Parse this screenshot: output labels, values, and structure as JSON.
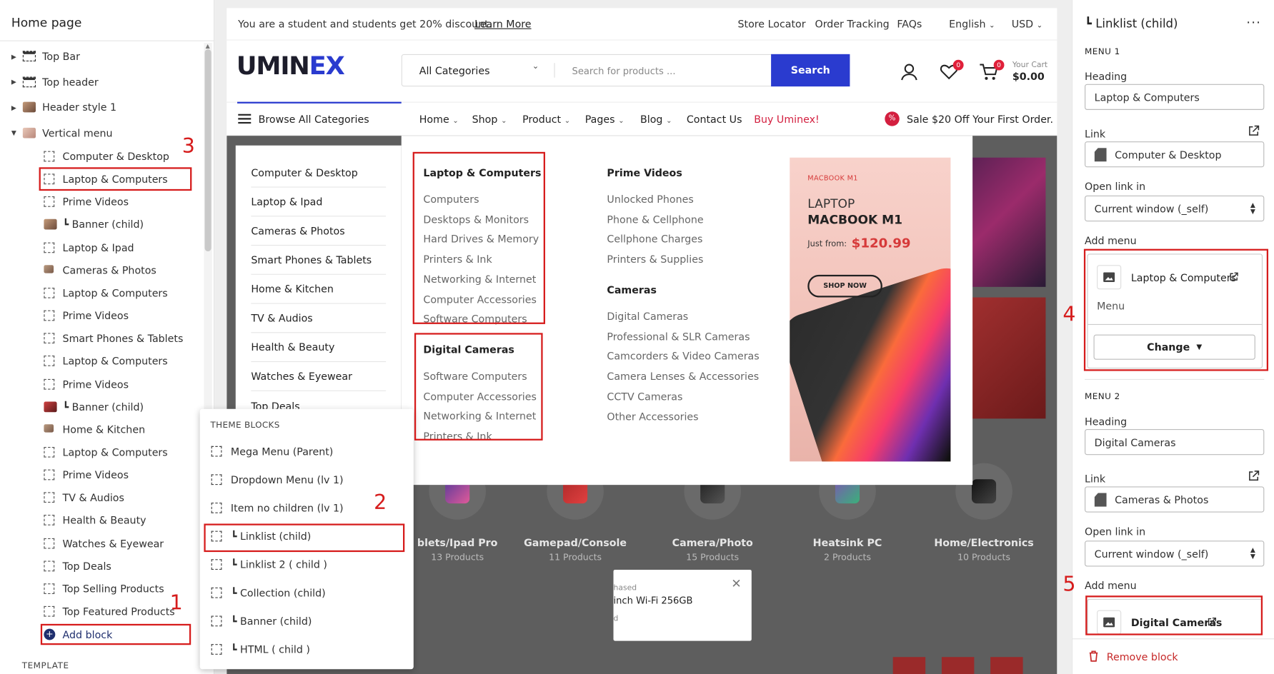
{
  "left_panel": {
    "title": "Home page",
    "tree": [
      {
        "label": "Top Bar",
        "type": "section",
        "icon": "section-bar-icon"
      },
      {
        "label": "Top header",
        "type": "section",
        "icon": "section-bar-icon"
      },
      {
        "label": "Header style 1",
        "type": "section",
        "icon": "image-thumb-icon"
      },
      {
        "label": "Vertical menu",
        "type": "section",
        "icon": "image-thumb-icon",
        "expanded": true
      },
      {
        "label": "Computer & Desktop",
        "type": "block",
        "icon": "frame-icon"
      },
      {
        "label": "Laptop & Computers",
        "type": "block",
        "icon": "frame-icon"
      },
      {
        "label": "Prime Videos",
        "type": "block",
        "icon": "frame-icon"
      },
      {
        "label": "┗ Banner (child)",
        "type": "block",
        "icon": "image-thumb-icon"
      },
      {
        "label": "Laptop & Ipad",
        "type": "block",
        "icon": "frame-icon"
      },
      {
        "label": "Cameras & Photos",
        "type": "block",
        "icon": "small-thumb-icon"
      },
      {
        "label": "Laptop & Computers",
        "type": "block",
        "icon": "frame-icon"
      },
      {
        "label": "Prime Videos",
        "type": "block",
        "icon": "frame-icon"
      },
      {
        "label": "Smart Phones & Tablets",
        "type": "block",
        "icon": "frame-icon"
      },
      {
        "label": "Laptop & Computers",
        "type": "block",
        "icon": "frame-icon"
      },
      {
        "label": "Prime Videos",
        "type": "block",
        "icon": "frame-icon"
      },
      {
        "label": "┗ Banner (child)",
        "type": "block",
        "icon": "red-thumb-icon"
      },
      {
        "label": "Home & Kitchen",
        "type": "block",
        "icon": "small-thumb-icon"
      },
      {
        "label": "Laptop & Computers",
        "type": "block",
        "icon": "frame-icon"
      },
      {
        "label": "Prime Videos",
        "type": "block",
        "icon": "frame-icon"
      },
      {
        "label": "TV & Audios",
        "type": "block",
        "icon": "frame-icon"
      },
      {
        "label": "Health & Beauty",
        "type": "block",
        "icon": "frame-icon"
      },
      {
        "label": "Watches & Eyewear",
        "type": "block",
        "icon": "frame-icon"
      },
      {
        "label": "Top Deals",
        "type": "block",
        "icon": "frame-icon"
      },
      {
        "label": "Top Selling Products",
        "type": "block",
        "icon": "frame-icon"
      },
      {
        "label": "Top Featured Products",
        "type": "block",
        "icon": "frame-icon"
      }
    ],
    "add_block": "Add block",
    "template_label": "TEMPLATE"
  },
  "annotations": [
    "1",
    "2",
    "3",
    "4",
    "5"
  ],
  "theme_blocks": {
    "heading": "THEME BLOCKS",
    "items": [
      "Mega Menu (Parent)",
      "Dropdown Menu (lv 1)",
      "Item no children (lv 1)",
      "┗ Linklist (child)",
      "┗ Linklist 2 ( child )",
      "┗ Collection (child)",
      "┗ Banner (child)",
      "┗ HTML ( child )"
    ]
  },
  "site": {
    "topbar": {
      "promo_text": "You are a student and students get 20% discount.",
      "promo_link": "Learn More",
      "links": [
        "Store Locator",
        "Order Tracking",
        "FAQs"
      ],
      "language": "English",
      "currency": "USD"
    },
    "header": {
      "logo": "UMINEX",
      "category_select": "All Categories",
      "search_placeholder": "Search for products ...",
      "search_button": "Search",
      "wishlist_count": "0",
      "cart_count": "0",
      "cart_label": "Your Cart",
      "cart_total": "$0.00"
    },
    "nav": {
      "browse": "Browse All Categories",
      "items": [
        "Home",
        "Shop",
        "Product",
        "Pages",
        "Blog",
        "Contact Us"
      ],
      "buy": "Buy Uminex!",
      "sale": "Sale $20 Off Your First Order."
    },
    "side_categories": [
      "Computer & Desktop",
      "Laptop & Ipad",
      "Cameras & Photos",
      "Smart Phones & Tablets",
      "Home & Kitchen",
      "TV & Audios",
      "Health & Beauty",
      "Watches & Eyewear",
      "Top Deals"
    ],
    "mega": {
      "col1_title": "Laptop & Computers",
      "col1_links": [
        "Computers",
        "Desktops & Monitors",
        "Hard Drives & Memory",
        "Printers & Ink",
        "Networking & Internet",
        "Computer Accessories",
        "Software Computers"
      ],
      "col1b_title": "Digital Cameras",
      "col1b_links": [
        "Software Computers",
        "Computer Accessories",
        "Networking & Internet",
        "Printers & Ink"
      ],
      "col2_title": "Prime Videos",
      "col2_links": [
        "Unlocked Phones",
        "Phone & Cellphone",
        "Cellphone Charges",
        "Printers & Supplies"
      ],
      "col2b_title": "Cameras",
      "col2b_links": [
        "Digital Cameras",
        "Professional & SLR Cameras",
        "Camcorders & Video Cameras",
        "Camera Lenses & Accessories",
        "CCTV Cameras",
        "Other Accessories"
      ],
      "promo": {
        "tag": "MACBOOK M1",
        "line1": "LAPTOP",
        "line2": "MACBOOK M1",
        "price_prefix": "Just from:",
        "price": "$120.99",
        "button": "SHOP NOW"
      }
    },
    "category_cards": [
      {
        "name": "blets/Ipad Pro",
        "count": "13 Products"
      },
      {
        "name": "Gamepad/Console",
        "count": "11 Products"
      },
      {
        "name": "Camera/Photo",
        "count": "15 Products"
      },
      {
        "name": "Heatsink PC",
        "count": "2 Products"
      },
      {
        "name": "Home/Electronics",
        "count": "10 Products"
      }
    ],
    "popup": {
      "line1": "hased",
      "line2": "inch Wi-Fi 256GB",
      "line3": "d"
    }
  },
  "right_panel": {
    "title": "┗ Linklist (child)",
    "menu1": {
      "caption": "MENU 1",
      "heading_label": "Heading",
      "heading_value": "Laptop & Computers",
      "link_label": "Link",
      "link_value": "Computer & Desktop",
      "open_label": "Open link in",
      "open_value": "Current window (_self)",
      "add_label": "Add menu",
      "card_title": "Laptop & Computers",
      "card_sub": "Menu",
      "change": "Change"
    },
    "menu2": {
      "caption": "MENU 2",
      "heading_label": "Heading",
      "heading_value": "Digital Cameras",
      "link_label": "Link",
      "link_value": "Cameras & Photos",
      "open_label": "Open link in",
      "open_value": "Current window (_self)",
      "add_label": "Add menu",
      "card_title": "Digital Cameras"
    },
    "remove": "Remove block"
  },
  "colors": {
    "accent": "#2a3bcf",
    "red": "#d61c1c",
    "badge": "#e0203a",
    "sale_red": "#d31f3f"
  }
}
